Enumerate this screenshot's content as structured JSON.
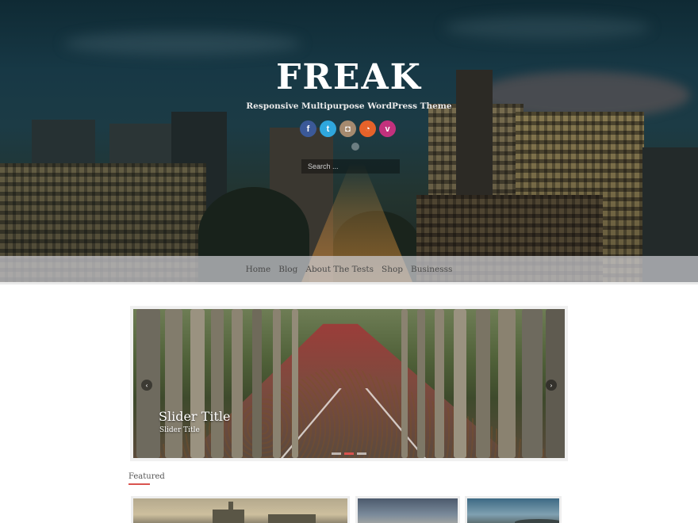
{
  "header": {
    "site_title": "FREAK",
    "site_description": "Responsive Multipurpose WordPress Theme",
    "social": [
      {
        "icon": "facebook-icon",
        "glyph": "f",
        "color": "#3b5998"
      },
      {
        "icon": "twitter-icon",
        "glyph": "t",
        "color": "#2fa7dd"
      },
      {
        "icon": "instagram-icon",
        "glyph": "◘",
        "color": "#a58a6f"
      },
      {
        "icon": "rss-icon",
        "glyph": "◔",
        "color": "#e5622a"
      },
      {
        "icon": "vimeo-icon",
        "glyph": "v",
        "color": "#c2317d"
      }
    ],
    "search_placeholder": "Search ..."
  },
  "nav": {
    "items": [
      "Home",
      "Blog",
      "About The Tests",
      "Shop",
      "Businesss"
    ]
  },
  "slider": {
    "title": "Slider Title",
    "subtitle": "Slider Title",
    "prev_glyph": "‹",
    "next_glyph": "›",
    "slide_count": 3,
    "active_slide": 2
  },
  "featured": {
    "label": "Featured"
  },
  "colors": {
    "accent": "#d9534f",
    "nav_bg": "#cdcdd2",
    "nav_text": "#4a4a4a"
  }
}
